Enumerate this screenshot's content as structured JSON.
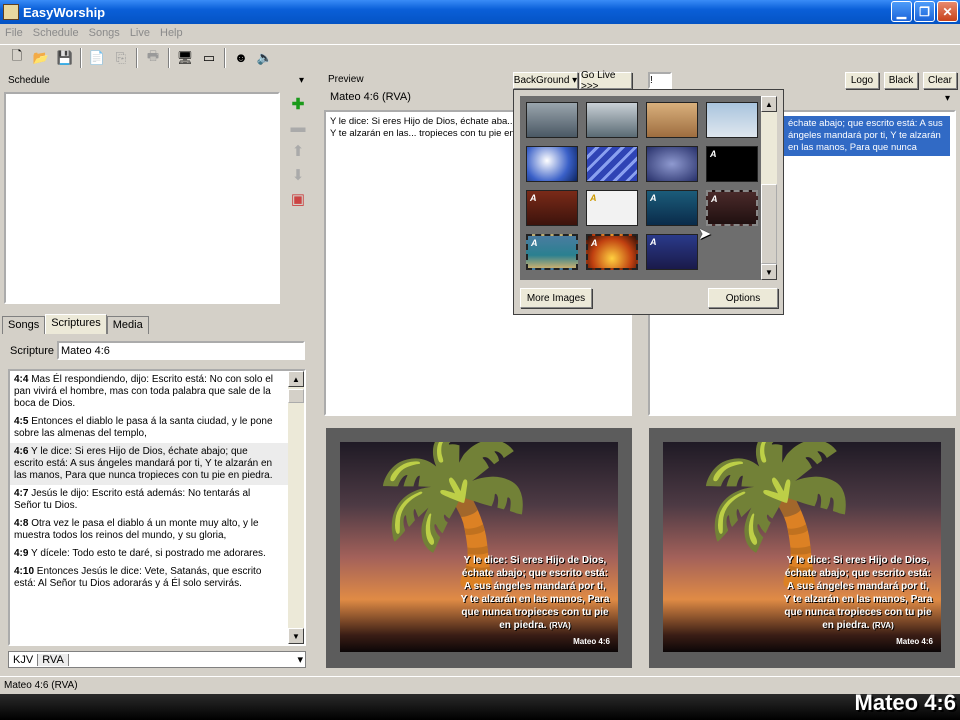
{
  "window": {
    "title": "EasyWorship"
  },
  "menu": [
    "File",
    "Schedule",
    "Songs",
    "Live",
    "Help"
  ],
  "schedule": {
    "header": "Schedule"
  },
  "tabs": [
    "Songs",
    "Scriptures",
    "Media"
  ],
  "scripture": {
    "label": "Scripture",
    "value": "Mateo 4:6"
  },
  "verses": [
    {
      "ref": "4:4",
      "text": " Mas Él respondiendo, dijo: Escrito está: No con solo el pan vivirá el hombre, mas con toda palabra que sale de la boca de Dios."
    },
    {
      "ref": "4:5",
      "text": " Entonces el diablo le pasa á la santa ciudad, y le pone sobre las almenas del templo,"
    },
    {
      "ref": "4:6",
      "text": " Y le dice: Si eres Hijo de Dios, échate abajo; que escrito está: A sus ángeles mandará por ti, Y te alzarán en las manos, Para que nunca tropieces con tu pie en piedra."
    },
    {
      "ref": "4:7",
      "text": " Jesús le dijo: Escrito está además: No tentarás al Señor tu Dios."
    },
    {
      "ref": "4:8",
      "text": " Otra vez le pasa el diablo á un monte muy alto, y le muestra todos los reinos del mundo, y su gloria,"
    },
    {
      "ref": "4:9",
      "text": " Y dícele: Todo esto te daré, si postrado me adorares."
    },
    {
      "ref": "4:10",
      "text": " Entonces Jesús le dice: Vete, Satanás, que escrito está: Al Señor tu Dios adorarás y á Él solo servirás."
    }
  ],
  "versions": [
    "KJV",
    "RVA"
  ],
  "preview": {
    "header": "Preview",
    "title": "Mateo 4:6 (RVA)",
    "background_label": "BackGround",
    "go_live_label": "Go Live >>>",
    "text": "Y le dice: Si eres Hijo de Dios, échate aba... ángeles mandará por ti, Y te alzarán en las... tropieces con tu pie en piedra."
  },
  "live": {
    "logo_label": "Logo",
    "black_label": "Black",
    "clear_label": "Clear",
    "text": "échate abajo; que escrito está: A sus ángeles mandará por ti, Y te alzarán en las manos, Para que nunca"
  },
  "screen_text": "Y le dice: Si eres Hijo de Dios, échate abajo; que escrito está: A sus ángeles mandará por ti, Y te alzarán en las manos, Para que nunca tropieces con tu pie en piedra.",
  "screen_version": "(RVA)",
  "screen_ref": "Mateo 4:6",
  "bg_popup": {
    "more_images_label": "More Images",
    "options_label": "Options"
  },
  "status": {
    "text": "Mateo 4:6 (RVA)"
  },
  "overlay_title": "Mateo 4:6"
}
